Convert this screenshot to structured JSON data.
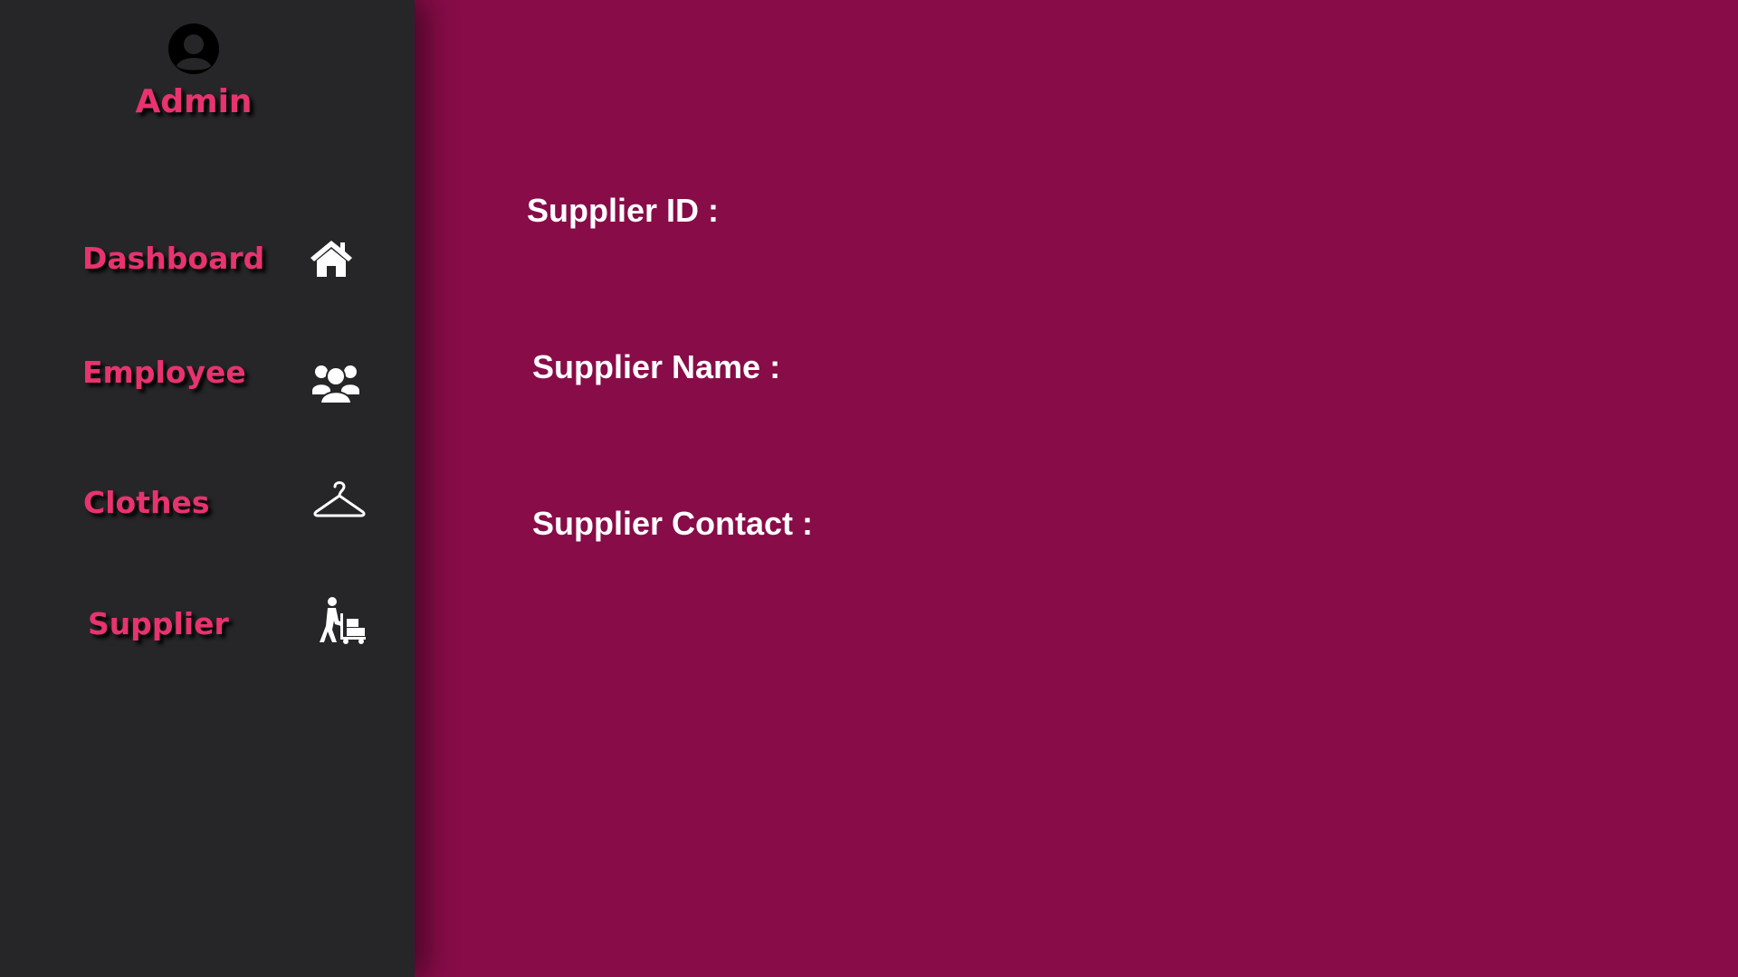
{
  "sidebar": {
    "user": {
      "name": "Admin",
      "avatar_icon": "user-circle-icon"
    },
    "items": [
      {
        "label": "Dashboard",
        "icon": "home-icon"
      },
      {
        "label": "Employee",
        "icon": "users-group-icon"
      },
      {
        "label": "Clothes",
        "icon": "hanger-icon"
      },
      {
        "label": "Supplier",
        "icon": "supplier-dolly-icon"
      }
    ]
  },
  "main": {
    "fields": [
      {
        "label": "Supplier ID :"
      },
      {
        "label": "Supplier Name :"
      },
      {
        "label": "Supplier Contact :"
      }
    ]
  },
  "colors": {
    "sidebar_bg": "#262628",
    "main_bg": "#870c48",
    "accent": "#e8336f",
    "label_text": "#ffffff"
  }
}
